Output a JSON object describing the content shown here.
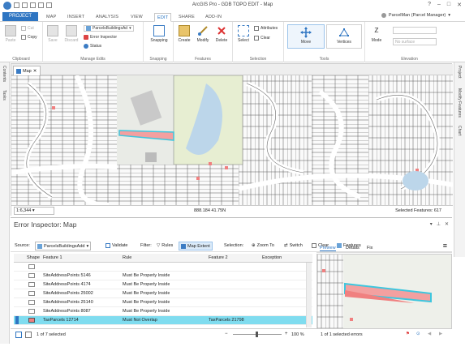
{
  "window": {
    "title": "ArcGIS Pro - GDB TOPO EDIT - Map",
    "controls": [
      "?",
      "–",
      "□",
      "✕"
    ]
  },
  "tabs": {
    "project": "PROJECT",
    "items": [
      "MAP",
      "INSERT",
      "ANALYSIS",
      "VIEW",
      "EDIT",
      "SHARE",
      "ADD-IN"
    ],
    "active": "EDIT"
  },
  "user": {
    "label": "ParcelMan (Parcel Manager)"
  },
  "ribbon": {
    "clipboard": {
      "label": "Clipboard",
      "paste": "Paste",
      "cut": "Cut",
      "copy": "Copy"
    },
    "manage_edits": {
      "label": "Manage Edits",
      "save": "Save",
      "discard": "Discard",
      "dropdown": "ParcelsBuildingsAd",
      "error_inspector": "Error Inspector",
      "status": "Status"
    },
    "snapping": {
      "label": "Snapping",
      "button": "Snapping"
    },
    "features": {
      "label": "Features",
      "create": "Create",
      "modify": "Modify",
      "delete": "Delete"
    },
    "selection": {
      "label": "Selection",
      "select": "Select",
      "attributes": "Attributes",
      "clear": "Clear"
    },
    "tools": {
      "label": "Tools",
      "move": "Move",
      "vertices": "Vertices"
    },
    "elevation": {
      "label": "Elevation",
      "mode": "Mode",
      "mode_input_placeholder": "",
      "no_surface": "No surface"
    }
  },
  "sidebars": {
    "left": [
      "Contents",
      "Tasks"
    ],
    "right": [
      "Project",
      "Modify Features",
      "Chart"
    ]
  },
  "map": {
    "tab_label": "Map",
    "scale": "1:6,344",
    "coordinates": "888.184  41.75N",
    "selected": "Selected Features: 617"
  },
  "error_inspector": {
    "title": "Error Inspector: Map",
    "source_label": "Source:",
    "source_value": "ParcelsBuildingsAdd",
    "validate": "Validate",
    "filter_label": "Filter:",
    "rules": "Rules",
    "map_extent": "Map Extent",
    "selection_label": "Selection:",
    "zoom_to": "Zoom To",
    "switch": "Switch",
    "clear": "Clear",
    "features": "Features",
    "columns": [
      "Shape",
      "Feature 1",
      "Rule",
      "Feature 2",
      "Exception"
    ],
    "rows": [
      {
        "feature1": "",
        "rule": "",
        "feature2": "",
        "selected": false
      },
      {
        "feature1": "SiteAddressPoints 5146",
        "rule": "Must Be Properly Inside",
        "feature2": "",
        "selected": false
      },
      {
        "feature1": "SiteAddressPoints 4174",
        "rule": "Must Be Properly Inside",
        "feature2": "",
        "selected": false
      },
      {
        "feature1": "SiteAddressPoints 25002",
        "rule": "Must Be Properly Inside",
        "feature2": "",
        "selected": false
      },
      {
        "feature1": "SiteAddressPoints 25140",
        "rule": "Must Be Properly Inside",
        "feature2": "",
        "selected": false
      },
      {
        "feature1": "SiteAddressPoints 8087",
        "rule": "Must Be Properly Inside",
        "feature2": "",
        "selected": false
      },
      {
        "feature1": "TaxParcels 12714",
        "rule": "Must Not Overlap",
        "feature2": "TaxParcels 21798",
        "selected": true
      }
    ],
    "preview_tabs": [
      "Preview",
      "Details",
      "Fix"
    ],
    "status_left": "1 of 7 selected",
    "zoom": "100 %",
    "status_right": "1 of 1 selected errors"
  },
  "colors": {
    "accent": "#2e75c2",
    "selection": "#7fdcef",
    "error_fill": "#f08080"
  }
}
